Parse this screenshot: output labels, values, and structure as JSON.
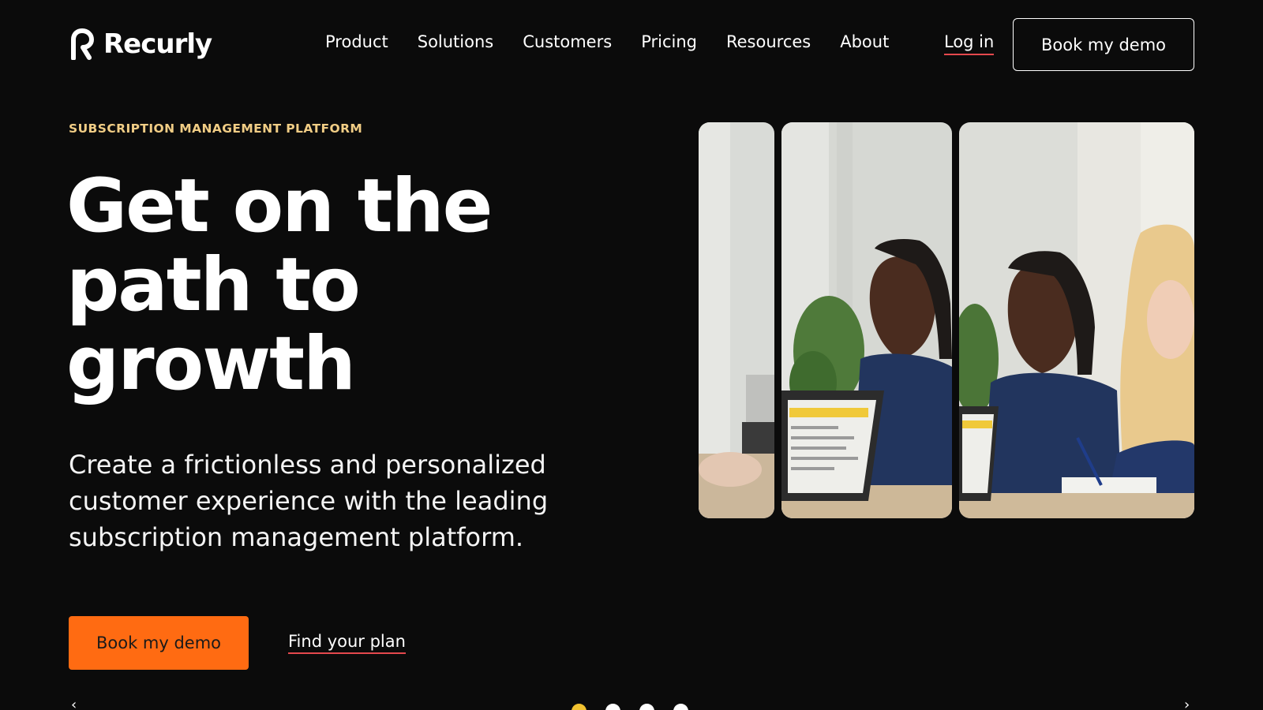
{
  "brand": {
    "name": "Recurly",
    "logo_icon": "recurly-r-mark-icon"
  },
  "nav": {
    "items": [
      {
        "label": "Product"
      },
      {
        "label": "Solutions"
      },
      {
        "label": "Customers"
      },
      {
        "label": "Pricing"
      },
      {
        "label": "Resources"
      },
      {
        "label": "About"
      }
    ],
    "login_label": "Log in",
    "demo_label": "Book my demo"
  },
  "hero": {
    "eyebrow": "SUBSCRIPTION MANAGEMENT PLATFORM",
    "headline_line1": "Get on the",
    "headline_line2": "path to",
    "headline_line3": "growth",
    "subhead": "Create a frictionless and personalized customer experience with the leading subscription management platform.",
    "primary_cta": "Book my demo",
    "secondary_cta": "Find your plan"
  },
  "carousel": {
    "prev_icon": "chevron-left-icon",
    "next_icon": "chevron-right-icon",
    "slide_count": 4,
    "active_index": 0
  },
  "colors": {
    "background": "#0b0b0b",
    "accent_orange": "#ff6b12",
    "eyebrow_gold": "#f1cd85",
    "underline_red": "#e5484d",
    "active_dot": "#f2c230"
  }
}
